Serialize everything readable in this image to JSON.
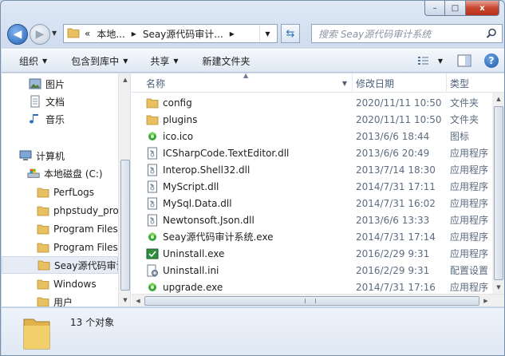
{
  "window": {
    "caption": {
      "min": "–",
      "max": "□",
      "close": "x"
    }
  },
  "nav": {
    "back_glyph": "◀",
    "forward_glyph": "▶",
    "breadcrumbs": [
      "«",
      "本地...",
      "▸",
      "Seay源代码审计...",
      "▸"
    ],
    "search_placeholder": "搜索 Seay源代码审计系统"
  },
  "toolbar": {
    "organize": "组织",
    "include_in_library": "包含到库中",
    "share": "共享",
    "new_folder": "新建文件夹"
  },
  "sidebar": {
    "items": [
      {
        "label": "图片",
        "icon": "pictures-icon"
      },
      {
        "label": "文档",
        "icon": "documents-icon"
      },
      {
        "label": "音乐",
        "icon": "music-icon"
      },
      {
        "label": "计算机",
        "icon": "computer-icon"
      },
      {
        "label": "本地磁盘 (C:)",
        "icon": "drive-icon"
      },
      {
        "label": "PerfLogs",
        "icon": "folder-icon"
      },
      {
        "label": "phpstudy_pro",
        "icon": "folder-icon"
      },
      {
        "label": "Program Files",
        "icon": "folder-icon"
      },
      {
        "label": "Program Files",
        "icon": "folder-icon"
      },
      {
        "label": "Seay源代码审计",
        "icon": "folder-icon"
      },
      {
        "label": "Windows",
        "icon": "folder-icon"
      },
      {
        "label": "用户",
        "icon": "folder-icon"
      }
    ]
  },
  "columns": {
    "name": "名称",
    "modified": "修改日期",
    "type": "类型"
  },
  "files": [
    {
      "name": "config",
      "date": "2020/11/11 10:50",
      "type": "文件夹",
      "icon": "folder-icon"
    },
    {
      "name": "plugins",
      "date": "2020/11/11 10:50",
      "type": "文件夹",
      "icon": "folder-icon"
    },
    {
      "name": "ico.ico",
      "date": "2013/6/6 18:44",
      "type": "图标",
      "icon": "ico-icon"
    },
    {
      "name": "ICSharpCode.TextEditor.dll",
      "date": "2013/6/6 20:49",
      "type": "应用程序",
      "icon": "dll-icon"
    },
    {
      "name": "Interop.Shell32.dll",
      "date": "2013/7/14 18:30",
      "type": "应用程序",
      "icon": "dll-icon"
    },
    {
      "name": "MyScript.dll",
      "date": "2014/7/31 17:11",
      "type": "应用程序",
      "icon": "dll-icon"
    },
    {
      "name": "MySql.Data.dll",
      "date": "2014/7/31 16:02",
      "type": "应用程序",
      "icon": "dll-icon"
    },
    {
      "name": "Newtonsoft.Json.dll",
      "date": "2013/6/6 13:33",
      "type": "应用程序",
      "icon": "dll-icon"
    },
    {
      "name": "Seay源代码审计系统.exe",
      "date": "2014/7/31 17:14",
      "type": "应用程序",
      "icon": "exe-icon"
    },
    {
      "name": "Uninstall.exe",
      "date": "2016/2/29 9:31",
      "type": "应用程序",
      "icon": "uninstall-icon"
    },
    {
      "name": "Uninstall.ini",
      "date": "2016/2/29 9:31",
      "type": "配置设置",
      "icon": "ini-icon"
    },
    {
      "name": "upgrade.exe",
      "date": "2014/7/31 17:16",
      "type": "应用程序",
      "icon": "exe-icon"
    }
  ],
  "status": {
    "count": "13 个对象"
  },
  "colors": {
    "accent": "#2a63b8",
    "folder": "#e8c062",
    "exe_green": "#3aa73a"
  }
}
